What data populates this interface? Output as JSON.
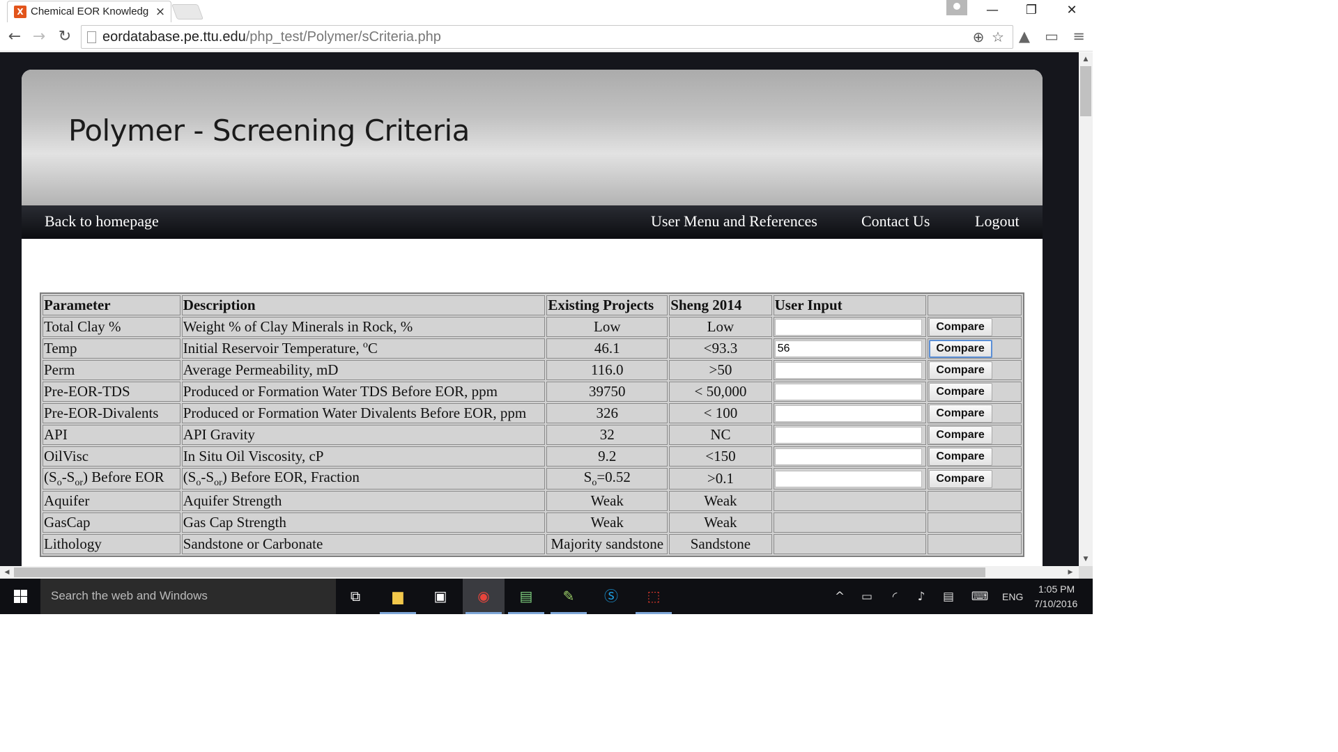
{
  "browser": {
    "tab_title": "Chemical EOR Knowledge",
    "tab_favicon": "X",
    "url_host": "eordatabase.pe.ttu.edu",
    "url_path": "/php_test/Polymer/sCriteria.php"
  },
  "page": {
    "title": "Polymer  -  Screening Criteria",
    "menu": {
      "back": "Back to homepage",
      "user_menu": "User Menu and References",
      "contact": "Contact Us",
      "logout": "Logout"
    }
  },
  "table": {
    "headers": [
      "Parameter",
      "Description",
      "Existing Projects",
      "Sheng 2014",
      "User Input",
      ""
    ],
    "compare_label": "Compare",
    "rows": [
      {
        "parameter": "Total Clay %",
        "description": "Weight % of Clay Minerals in Rock, %",
        "existing": "Low",
        "sheng": "Low",
        "input": ""
      },
      {
        "parameter": "Temp",
        "description": "Initial Reservoir Temperature, ",
        "desc_sup": "o",
        "desc_tail": "C",
        "existing": "46.1",
        "sheng": "<93.3",
        "input": "56"
      },
      {
        "parameter": "Perm",
        "description": "Average Permeability, mD",
        "existing": "116.0",
        "sheng": ">50",
        "input": ""
      },
      {
        "parameter": "Pre-EOR-TDS",
        "description": "Produced or Formation Water TDS Before EOR, ppm",
        "existing": "39750",
        "sheng": "< 50,000",
        "input": ""
      },
      {
        "parameter": "Pre-EOR-Divalents",
        "description": "Produced or Formation Water Divalents Before EOR, ppm",
        "existing": "326",
        "sheng": "< 100",
        "input": ""
      },
      {
        "parameter": "API",
        "description": "API Gravity",
        "existing": "32",
        "sheng": "NC",
        "input": ""
      },
      {
        "parameter": "OilVisc",
        "description": "In Situ Oil Viscosity, cP",
        "existing": "9.2",
        "sheng": "<150",
        "input": ""
      },
      {
        "parameter_rich": [
          "(S",
          "o",
          "-S",
          "or",
          ") Before EOR"
        ],
        "description_rich": [
          "(S",
          "o",
          "-S",
          "or",
          ") Before EOR, Fraction"
        ],
        "existing_rich": [
          "S",
          "o",
          "=0.52"
        ],
        "sheng": ">0.1",
        "input": ""
      },
      {
        "parameter": "Aquifer",
        "description": "Aquifer Strength",
        "existing": "Weak",
        "sheng": "Weak"
      },
      {
        "parameter": "GasCap",
        "description": "Gas Cap Strength",
        "existing": "Weak",
        "sheng": "Weak"
      },
      {
        "parameter": "Lithology",
        "description": "Sandstone or Carbonate",
        "existing": "Majority sandstone",
        "sheng": "Sandstone"
      }
    ]
  },
  "taskbar": {
    "search_placeholder": "Search the web and Windows",
    "language": "ENG",
    "time": "1:05 PM",
    "date": "7/10/2016"
  }
}
